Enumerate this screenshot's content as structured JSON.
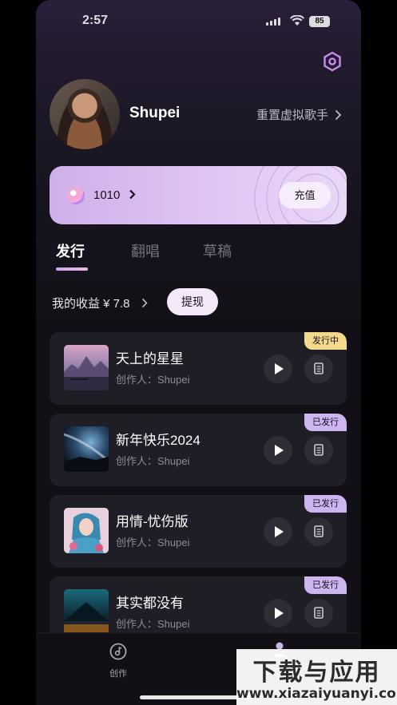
{
  "status_bar": {
    "time": "2:57",
    "battery": "85"
  },
  "profile": {
    "username": "Shupei",
    "reset_singer_label": "重置虚拟歌手"
  },
  "wallet": {
    "coins": "1010",
    "recharge_label": "充值"
  },
  "tabs": [
    {
      "label": "发行",
      "active": true
    },
    {
      "label": "翻唱",
      "active": false
    },
    {
      "label": "草稿",
      "active": false
    }
  ],
  "earnings": {
    "label": "我的收益 ¥ 7.8",
    "withdraw_label": "提现"
  },
  "songs": [
    {
      "title": "天上的星星",
      "creator": "创作人：Shupei",
      "status": "发行中",
      "status_color": "#f3d98a"
    },
    {
      "title": "新年快乐2024",
      "creator": "创作人：Shupei",
      "status": "已发行",
      "status_color": "#cdb6f0"
    },
    {
      "title": "用情-忧伤版",
      "creator": "创作人：Shupei",
      "status": "已发行",
      "status_color": "#cdb6f0"
    },
    {
      "title": "其实都没有",
      "creator": "创作人：Shupei",
      "status": "已发行",
      "status_color": "#cdb6f0"
    }
  ],
  "bottom_nav": {
    "create_label": "创作"
  },
  "watermark": {
    "line1": "下载与应用",
    "line2": "www.xiazaiyuanyi.com"
  }
}
